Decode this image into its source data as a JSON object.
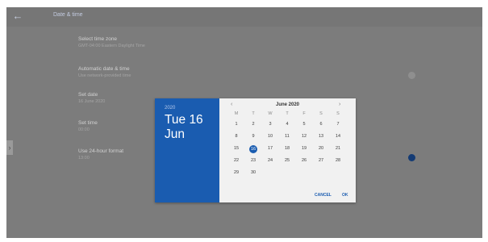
{
  "header": {
    "title": "Date & time"
  },
  "settings": [
    {
      "primary": "Select time zone",
      "secondary": "GMT-04:00 Eastern Daylight Time"
    },
    {
      "primary": "Automatic date & time",
      "secondary": "Use network-provided time"
    },
    {
      "primary": "Set date",
      "secondary": "16 June 2020"
    },
    {
      "primary": "Set time",
      "secondary": "00:00"
    },
    {
      "primary": "Use 24-hour format",
      "secondary": "13:00"
    }
  ],
  "toggles": {
    "automatic_date_time": "off",
    "use_24_hour": "on"
  },
  "dialog": {
    "year": "2020",
    "date_line1": "Tue 16",
    "date_line2": "Jun",
    "month_label": "June 2020",
    "prev_icon": "chevron-left-icon",
    "next_icon": "chevron-right-icon",
    "weekdays": [
      "M",
      "T",
      "W",
      "T",
      "F",
      "S",
      "S"
    ],
    "weeks": [
      [
        "1",
        "2",
        "3",
        "4",
        "5",
        "6",
        "7"
      ],
      [
        "8",
        "9",
        "10",
        "11",
        "12",
        "13",
        "14"
      ],
      [
        "15",
        "16",
        "17",
        "18",
        "19",
        "20",
        "21"
      ],
      [
        "22",
        "23",
        "24",
        "25",
        "26",
        "27",
        "28"
      ],
      [
        "29",
        "30",
        "",
        "",
        "",
        "",
        ""
      ]
    ],
    "selected_day": "16",
    "cancel_label": "CANCEL",
    "ok_label": "OK"
  },
  "colors": {
    "accent": "#1a5cb0",
    "scrim": "#7c7c7c"
  }
}
